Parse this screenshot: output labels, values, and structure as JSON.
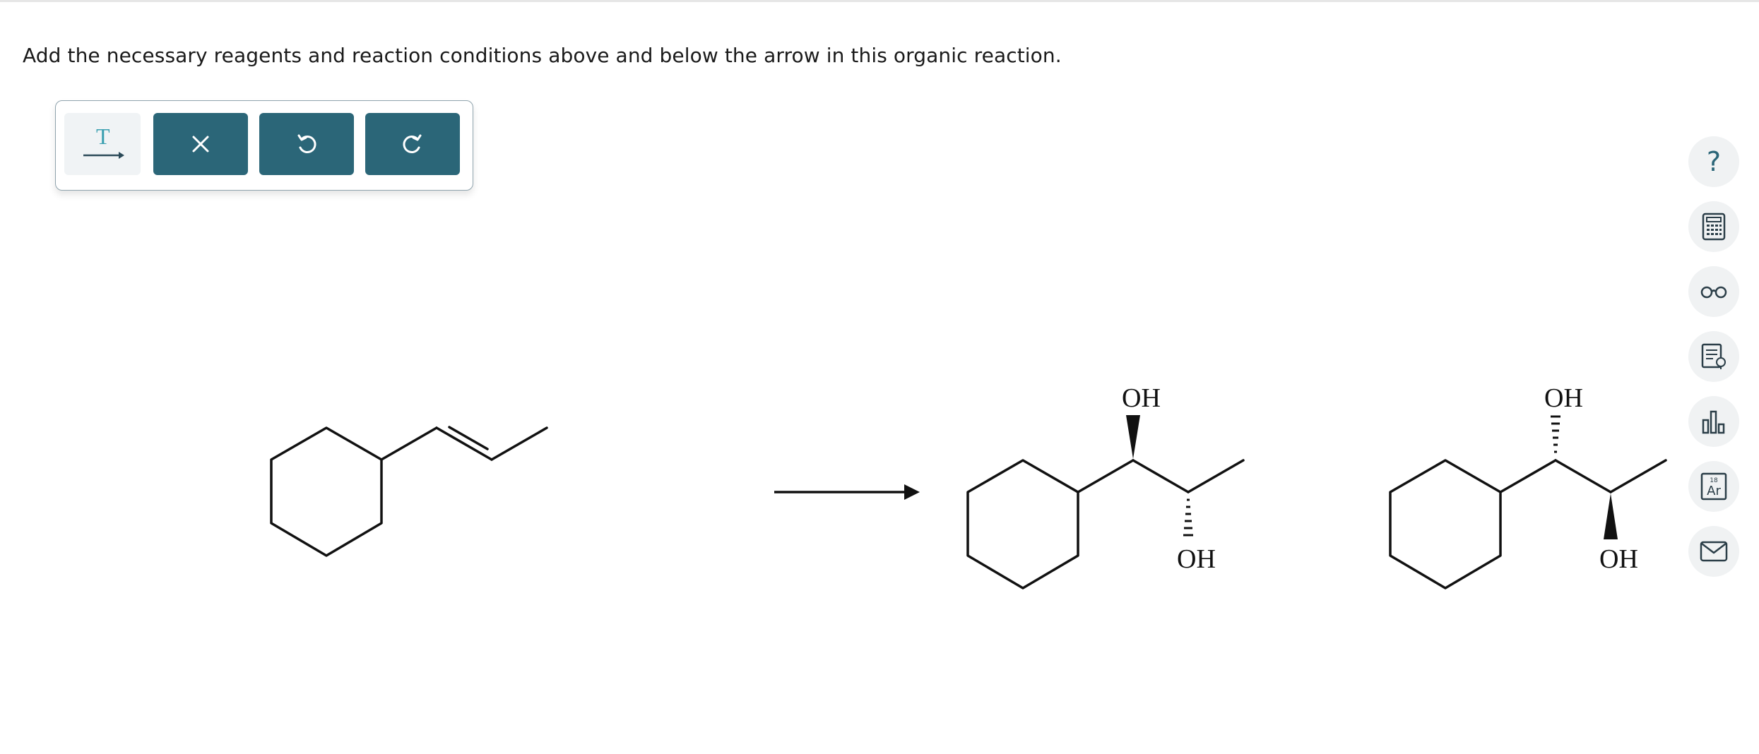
{
  "prompt": "Add the necessary reagents and reaction conditions above and below the arrow in this organic reaction.",
  "toolbar": {
    "text_tool_glyph": "T",
    "buttons": [
      {
        "name": "clear-button",
        "icon": "close-icon"
      },
      {
        "name": "undo-button",
        "icon": "undo-icon"
      },
      {
        "name": "redo-button",
        "icon": "redo-icon"
      }
    ]
  },
  "sidebar": [
    {
      "name": "help",
      "icon": "question-icon",
      "glyph": "?"
    },
    {
      "name": "calculator",
      "icon": "calculator-icon"
    },
    {
      "name": "reading-glasses",
      "icon": "glasses-icon"
    },
    {
      "name": "notes",
      "icon": "notes-icon"
    },
    {
      "name": "data",
      "icon": "bar-chart-icon"
    },
    {
      "name": "periodic-table",
      "icon": "periodic-element-icon",
      "element_number": "18",
      "element_symbol": "Ar"
    },
    {
      "name": "message",
      "icon": "envelope-icon"
    }
  ],
  "reaction": {
    "product1": {
      "label_top": "OH",
      "label_bottom": "OH"
    },
    "product2": {
      "label_top": "OH",
      "label_bottom": "OH"
    }
  },
  "colors": {
    "accent": "#2b6678",
    "toolbar_border": "#8fa3ad",
    "sidebar_bg": "#f0f2f3",
    "text_tool_color": "#3a9fb0"
  }
}
